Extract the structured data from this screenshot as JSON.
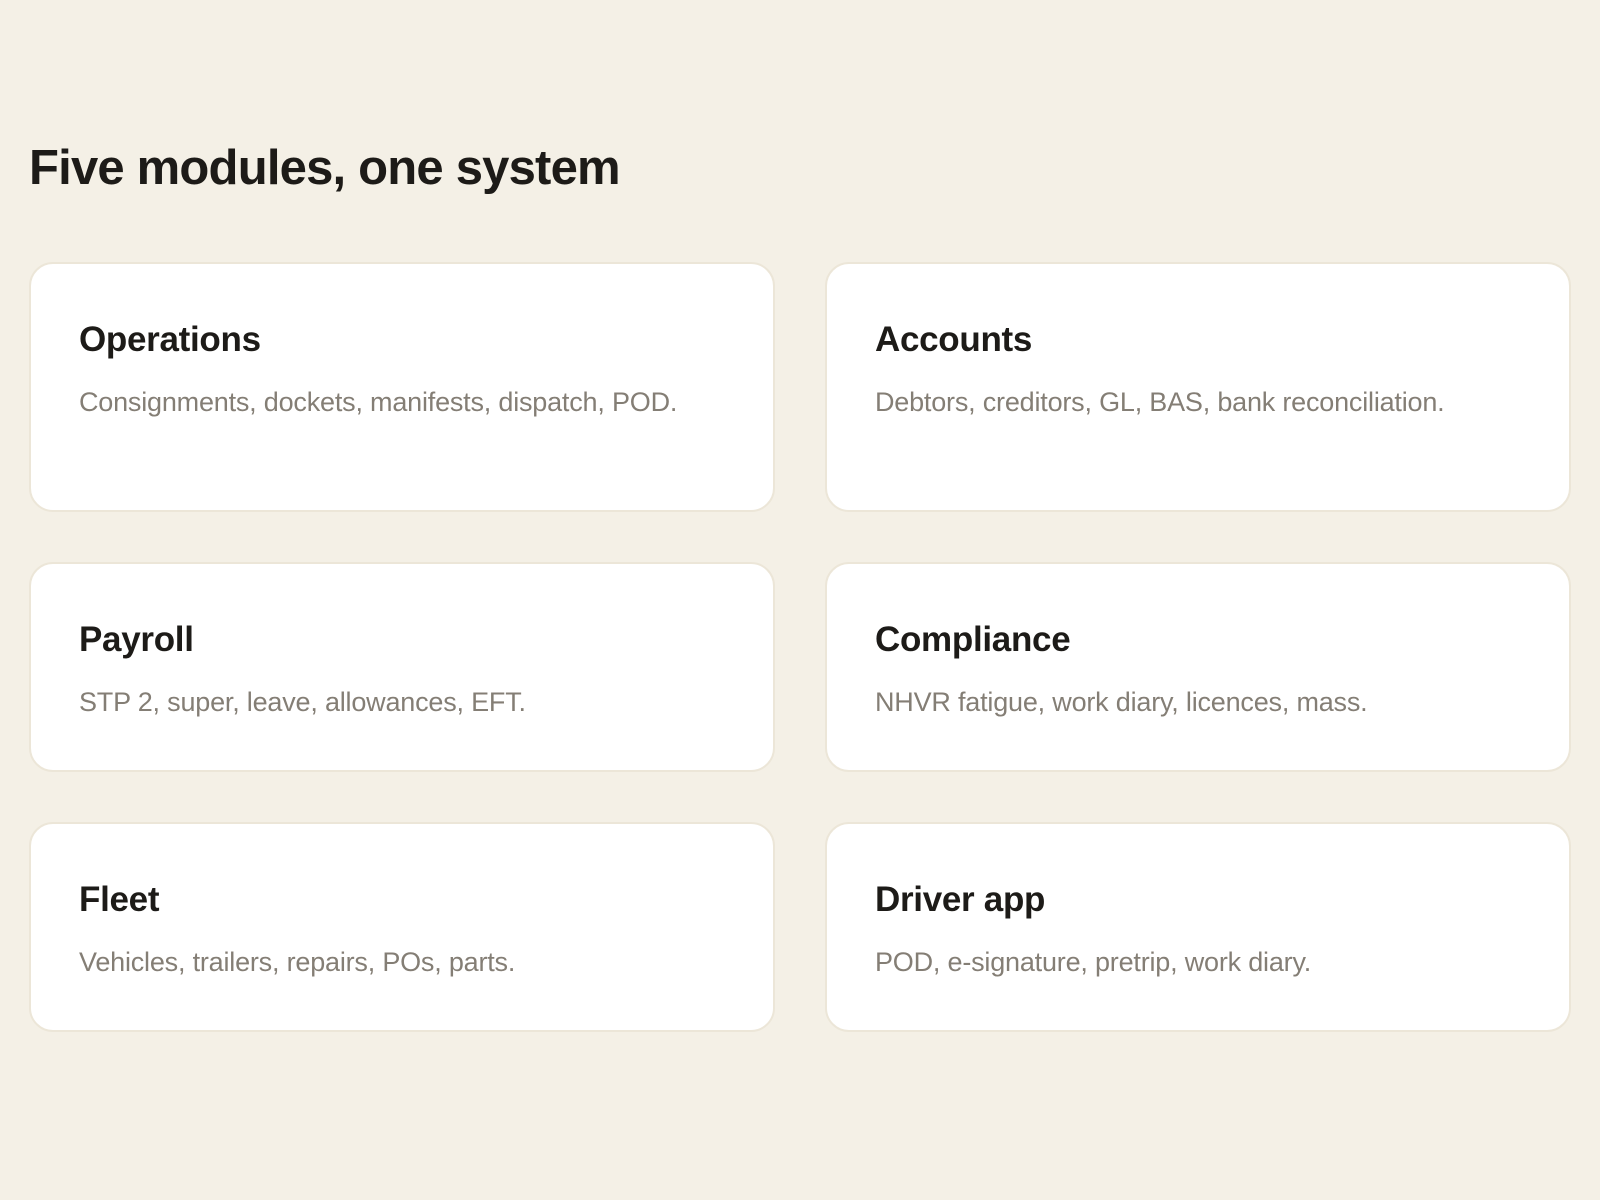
{
  "section": {
    "title": "Five modules, one system"
  },
  "modules": [
    {
      "title": "Operations",
      "description": "Consignments, dockets, manifests, dispatch, POD."
    },
    {
      "title": "Accounts",
      "description": "Debtors, creditors, GL, BAS, bank reconciliation."
    },
    {
      "title": "Payroll",
      "description": "STP 2, super, leave, allowances, EFT."
    },
    {
      "title": "Compliance",
      "description": "NHVR fatigue, work diary, licences, mass."
    },
    {
      "title": "Fleet",
      "description": "Vehicles, trailers, repairs, POs, parts."
    },
    {
      "title": "Driver app",
      "description": "POD, e-signature, pretrip, work diary."
    }
  ],
  "colors": {
    "background": "#f4f0e6",
    "card": "#ffffff",
    "card_border": "#ece6d8",
    "heading": "#1d1b18",
    "muted_text": "#847e75"
  }
}
